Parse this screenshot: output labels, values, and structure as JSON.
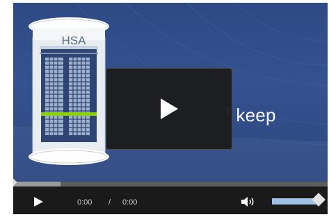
{
  "slide": {
    "server_label": "HSA",
    "text": "o keep"
  },
  "player": {
    "progress_fraction": 0.15,
    "current_time": "0:00",
    "time_separator": "/",
    "duration": "0:00",
    "volume_fraction": 1.0
  },
  "icons": {
    "overlay": "play-icon",
    "control_play": "play-icon",
    "volume": "volume-icon"
  },
  "colors": {
    "background_blue": "#2d4a85",
    "server_body": "#f4f6f8",
    "server_grid": "#2e4475",
    "server_grid_cell": "#9eb0c9",
    "highlight_green": "#8bd000",
    "control_bar": "#1a1a1a",
    "volume_fill": "#9fc1e4"
  }
}
